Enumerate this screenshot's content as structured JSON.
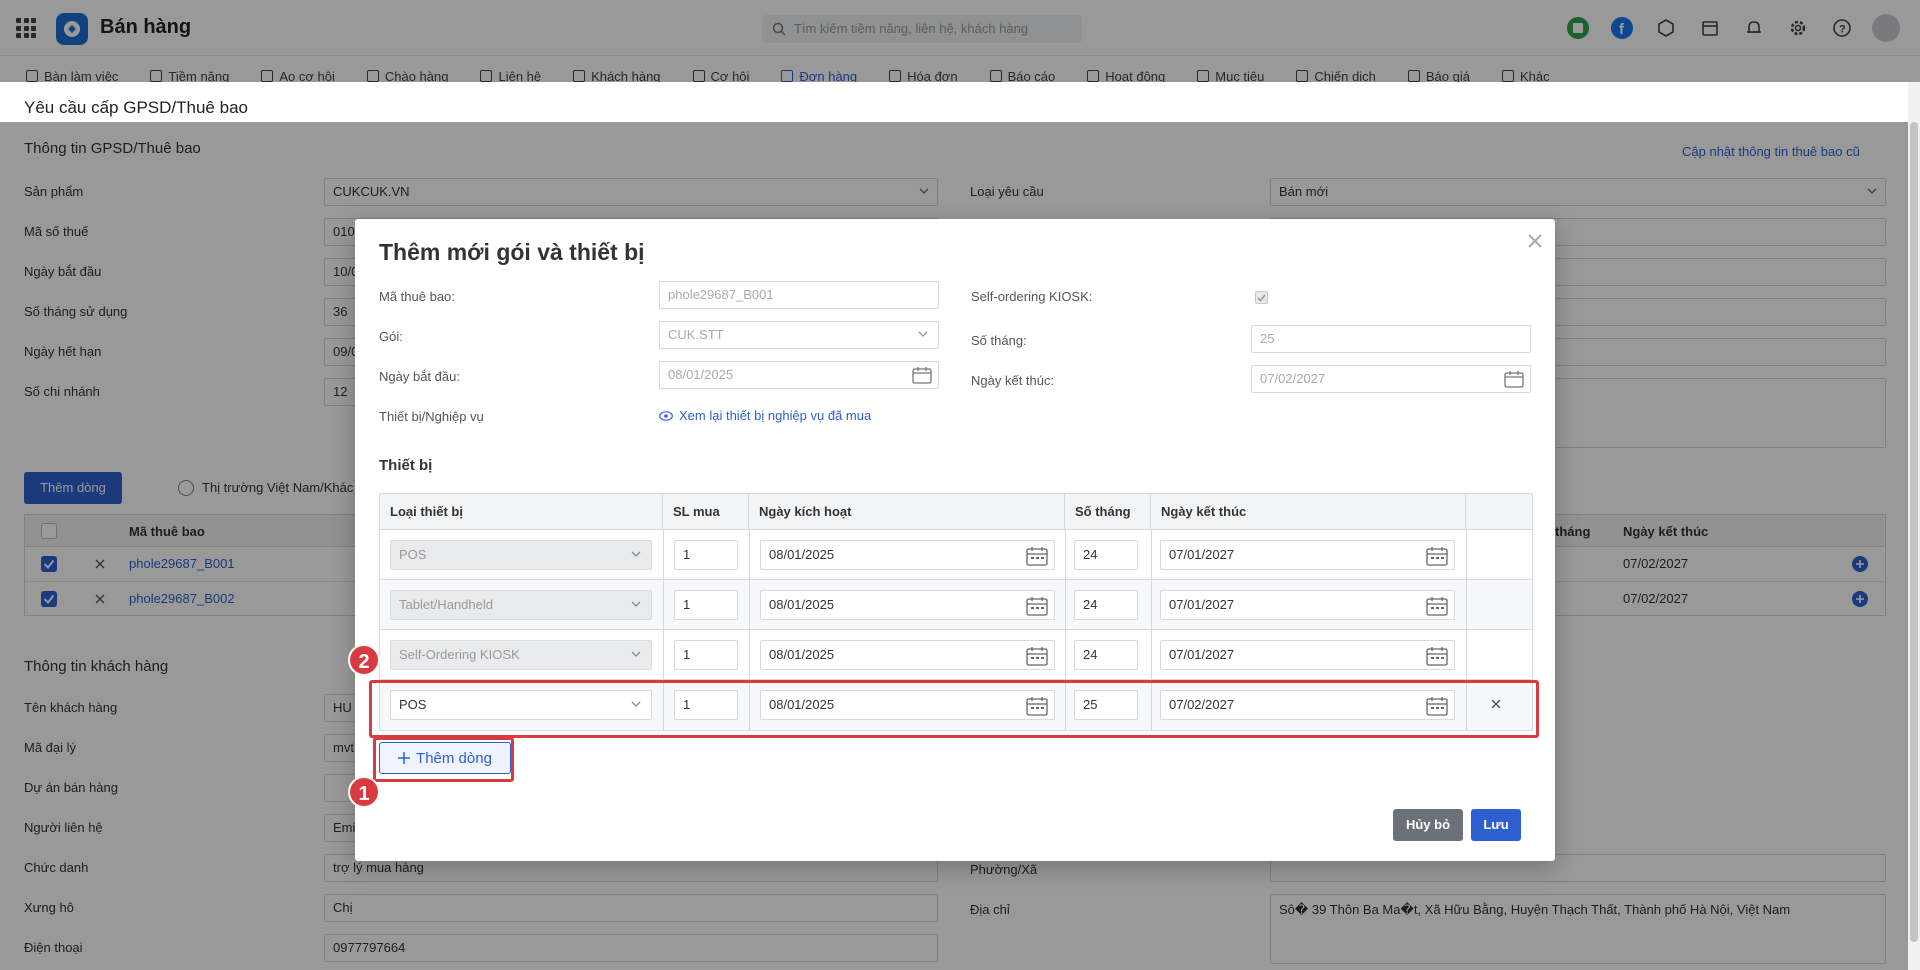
{
  "app": {
    "title": "Bán hàng",
    "search_placeholder": "Tìm kiếm tiềm năng, liên hệ, khách hàng"
  },
  "nav": [
    {
      "label": "Bàn làm việc"
    },
    {
      "label": "Tiềm năng"
    },
    {
      "label": "Ao cơ hội"
    },
    {
      "label": "Chào hàng"
    },
    {
      "label": "Liên hệ"
    },
    {
      "label": "Khách hàng"
    },
    {
      "label": "Cơ hội"
    },
    {
      "label": "Đơn hàng"
    },
    {
      "label": "Hóa đơn"
    },
    {
      "label": "Báo cáo"
    },
    {
      "label": "Hoạt động"
    },
    {
      "label": "Mục tiêu"
    },
    {
      "label": "Chiến dịch"
    },
    {
      "label": "Báo giá"
    },
    {
      "label": "Khác"
    }
  ],
  "page": {
    "title": "Yêu cầu cấp GPSD/Thuê bao",
    "section_gpsd": "Thông tin GPSD/Thuê bao",
    "update_link": "Cập nhật thông tin thuê bao cũ",
    "fields_left": [
      {
        "label": "Sản phẩm",
        "value": "CUKCUK.VN"
      },
      {
        "label": "Mã số thuế",
        "value": "010"
      },
      {
        "label": "Ngày bắt đầu",
        "value": "10/0"
      },
      {
        "label": "Số tháng sử dụng",
        "value": "36"
      },
      {
        "label": "Ngày hết hạn",
        "value": "09/0"
      },
      {
        "label": "Số chi nhánh",
        "value": "12"
      }
    ],
    "field_right_label": "Loại yêu cầu",
    "field_right_value": "Bán mới",
    "add_row_button": "Thêm dòng",
    "market_radio": "Thị trường Việt Nam/Khác",
    "grid_header_code": "Mã thuê bao",
    "grid_header_months": "tháng",
    "grid_header_end": "Ngày kết thúc",
    "grid_rows": [
      {
        "code": "phole29687_B001",
        "end": "07/02/2027"
      },
      {
        "code": "phole29687_B002",
        "end": "07/02/2027"
      }
    ],
    "section_customer": "Thông tin khách hàng",
    "customer_fields": [
      {
        "label": "Tên khách hàng",
        "value": "HU"
      },
      {
        "label": "Mã đại lý",
        "value": "mvt"
      },
      {
        "label": "Dự án bán hàng",
        "value": ""
      },
      {
        "label": "Người liên hệ",
        "value": "Emi"
      },
      {
        "label": "Chức danh",
        "value": "trợ lý mua hàng"
      },
      {
        "label": "Xưng hô",
        "value": "Chị"
      },
      {
        "label": "Điện thoại",
        "value": "0977797664"
      }
    ],
    "ward_label": "Phường/Xã",
    "address_label": "Địa chỉ",
    "address_value": "Sô� 39 Thôn Ba Ma�t, Xã Hữu Bằng, Huyện Thạch Thất, Thành phố Hà Nội, Việt Nam"
  },
  "modal": {
    "title": "Thêm mới gói và thiết bị",
    "subscriber_label": "Mã thuê bao:",
    "subscriber_value": "phole29687_B001",
    "package_label": "Gói:",
    "package_value": "CUK.STT",
    "start_label": "Ngày bắt đầu:",
    "start_value": "08/01/2025",
    "device_label": "Thiết bị/Nghiệp vụ",
    "view_link": "Xem lại thiết bị nghiệp vụ đã mua",
    "kiosk_label": "Self-ordering KIOSK:",
    "kiosk_checked": true,
    "months_label": "Số tháng:",
    "months_value": "25",
    "end_label": "Ngày kết thúc:",
    "end_value": "07/02/2027",
    "table_title": "Thiết bị",
    "columns": [
      "Loại thiết bị",
      "SL mua",
      "Ngày kích hoạt",
      "Số tháng",
      "Ngày kết thúc"
    ],
    "rows": [
      {
        "type": "POS",
        "qty": "1",
        "activate": "08/01/2025",
        "months": "24",
        "end": "07/01/2027",
        "locked": true
      },
      {
        "type": "Tablet/Handheld",
        "qty": "1",
        "activate": "08/01/2025",
        "months": "24",
        "end": "07/01/2027",
        "locked": true
      },
      {
        "type": "Self-Ordering KIOSK",
        "qty": "1",
        "activate": "08/01/2025",
        "months": "24",
        "end": "07/01/2027",
        "locked": true
      },
      {
        "type": "POS",
        "qty": "1",
        "activate": "08/01/2025",
        "months": "25",
        "end": "07/02/2027",
        "locked": false
      }
    ],
    "add_row": "Thêm dòng",
    "cancel": "Hủy bỏ",
    "save": "Lưu"
  },
  "annotations": {
    "step1": "1",
    "step2": "2"
  },
  "colors": {
    "primary": "#2e5fd0",
    "highlight": "#d93a3f",
    "cancel": "#6b7178"
  }
}
